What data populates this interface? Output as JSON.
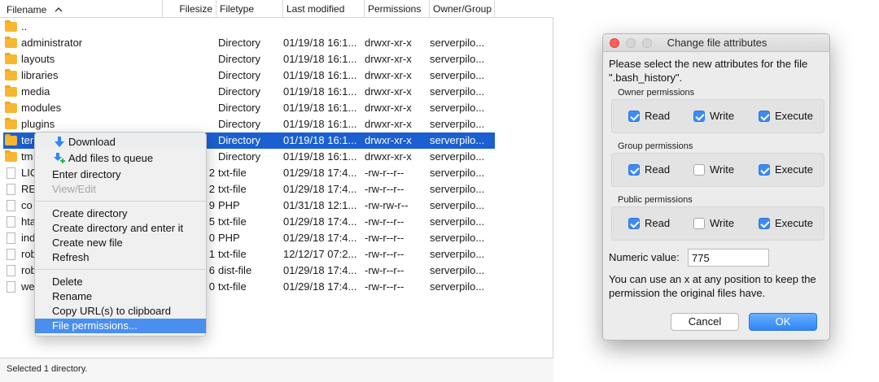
{
  "filelist": {
    "columns": {
      "name": "Filename",
      "size": "Filesize",
      "type": "Filetype",
      "modified": "Last modified",
      "permissions": "Permissions",
      "owner": "Owner/Group"
    },
    "rows": [
      {
        "icon": "folder-icon",
        "name": "..",
        "size": "",
        "type": "",
        "modified": "",
        "permissions": "",
        "owner": ""
      },
      {
        "icon": "folder-icon",
        "name": "administrator",
        "size": "",
        "type": "Directory",
        "modified": "01/19/18 16:1...",
        "permissions": "drwxr-xr-x",
        "owner": "serverpilo..."
      },
      {
        "icon": "folder-icon",
        "name": "layouts",
        "size": "",
        "type": "Directory",
        "modified": "01/19/18 16:1...",
        "permissions": "drwxr-xr-x",
        "owner": "serverpilo..."
      },
      {
        "icon": "folder-icon",
        "name": "libraries",
        "size": "",
        "type": "Directory",
        "modified": "01/19/18 16:1...",
        "permissions": "drwxr-xr-x",
        "owner": "serverpilo..."
      },
      {
        "icon": "folder-icon",
        "name": "media",
        "size": "",
        "type": "Directory",
        "modified": "01/19/18 16:1...",
        "permissions": "drwxr-xr-x",
        "owner": "serverpilo..."
      },
      {
        "icon": "folder-icon",
        "name": "modules",
        "size": "",
        "type": "Directory",
        "modified": "01/19/18 16:1...",
        "permissions": "drwxr-xr-x",
        "owner": "serverpilo..."
      },
      {
        "icon": "folder-icon",
        "name": "plugins",
        "size": "",
        "type": "Directory",
        "modified": "01/19/18 16:1...",
        "permissions": "drwxr-xr-x",
        "owner": "serverpilo..."
      },
      {
        "icon": "folder-icon",
        "name": "ter",
        "size": "",
        "type": "Directory",
        "modified": "01/19/18 16:1...",
        "permissions": "drwxr-xr-x",
        "owner": "serverpilo...",
        "selected": true
      },
      {
        "icon": "folder-icon",
        "name": "tm",
        "size": "",
        "type": "Directory",
        "modified": "01/19/18 16:1...",
        "permissions": "drwxr-xr-x",
        "owner": "serverpilo..."
      },
      {
        "icon": "file-icon",
        "name": "LIC",
        "size": "2",
        "type": "txt-file",
        "modified": "01/29/18 17:4...",
        "permissions": "-rw-r--r--",
        "owner": "serverpilo..."
      },
      {
        "icon": "file-icon",
        "name": "RE",
        "size": "2",
        "type": "txt-file",
        "modified": "01/29/18 17:4...",
        "permissions": "-rw-r--r--",
        "owner": "serverpilo..."
      },
      {
        "icon": "file-icon",
        "name": "co",
        "size": "9",
        "type": "PHP",
        "modified": "01/31/18 12:1...",
        "permissions": "-rw-rw-r--",
        "owner": "serverpilo..."
      },
      {
        "icon": "file-icon",
        "name": "hta",
        "size": "5",
        "type": "txt-file",
        "modified": "01/29/18 17:4...",
        "permissions": "-rw-r--r--",
        "owner": "serverpilo..."
      },
      {
        "icon": "file-icon",
        "name": "ind",
        "size": "0",
        "type": "PHP",
        "modified": "01/29/18 17:4...",
        "permissions": "-rw-r--r--",
        "owner": "serverpilo..."
      },
      {
        "icon": "file-icon",
        "name": "rob",
        "size": "1",
        "type": "txt-file",
        "modified": "12/12/17 07:2...",
        "permissions": "-rw-r--r--",
        "owner": "serverpilo..."
      },
      {
        "icon": "file-icon",
        "name": "rob",
        "size": "6",
        "type": "dist-file",
        "modified": "01/29/18 17:4...",
        "permissions": "-rw-r--r--",
        "owner": "serverpilo..."
      },
      {
        "icon": "file-icon",
        "name": "we",
        "size": "0",
        "type": "txt-file",
        "modified": "01/29/18 17:4...",
        "permissions": "-rw-r--r--",
        "owner": "serverpilo..."
      }
    ],
    "status": "Selected 1 directory."
  },
  "context_menu": {
    "download": "Download",
    "add_to_queue": "Add files to queue",
    "enter_directory": "Enter directory",
    "view_edit": "View/Edit",
    "create_directory": "Create directory",
    "create_directory_enter": "Create directory and enter it",
    "create_new_file": "Create new file",
    "refresh": "Refresh",
    "delete": "Delete",
    "rename": "Rename",
    "copy_urls": "Copy URL(s) to clipboard",
    "file_permissions": "File permissions..."
  },
  "dialog": {
    "title": "Change file attributes",
    "prompt_line1": "Please select the new attributes for the file",
    "prompt_line2": "\".bash_history\".",
    "groups": [
      {
        "label": "Owner permissions",
        "read": true,
        "write": true,
        "execute": true
      },
      {
        "label": "Group permissions",
        "read": true,
        "write": false,
        "execute": true
      },
      {
        "label": "Public permissions",
        "read": true,
        "write": false,
        "execute": true
      }
    ],
    "read_label": "Read",
    "write_label": "Write",
    "execute_label": "Execute",
    "numeric_label": "Numeric value:",
    "numeric_value": "775",
    "hint_line1": "You can use an x at any position to keep the",
    "hint_line2": "permission the original files have.",
    "cancel": "Cancel",
    "ok": "OK"
  },
  "colors": {
    "selection": "#1b5fd1",
    "menu_highlight": "#4a8ff0",
    "checkbox_on": "#3b8cf5",
    "folder": "#f7b731"
  }
}
